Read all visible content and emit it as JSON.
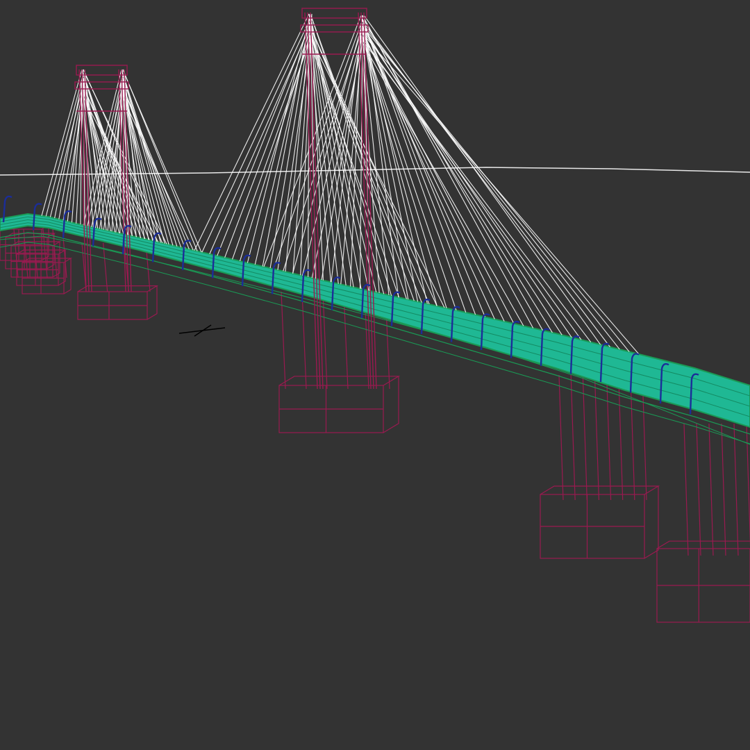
{
  "viewport": {
    "view": "perspective",
    "render_mode": "wireframe",
    "background_color": "#333333"
  },
  "scene": {
    "model": "cable-stayed-bridge",
    "tower_count": 2,
    "pier_count": 5,
    "lamp_posts_visible": 24,
    "colors": {
      "towers_and_piers": "#9a1a50",
      "stay_cables": "#ffffff",
      "deck_surface": "#1fb894",
      "deck_edges": "#1a9a55",
      "lamp_posts": "#1b2d99",
      "horizon_line": "#e8e8e8",
      "gizmo": "#000000"
    }
  }
}
